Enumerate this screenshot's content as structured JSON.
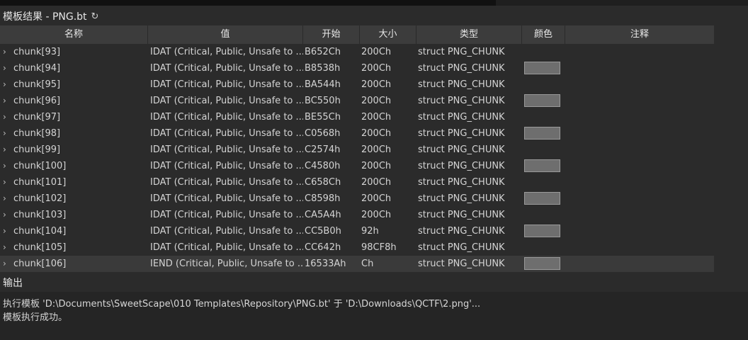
{
  "panel": {
    "title": "模板结果 - PNG.bt",
    "refresh_icon": "↻"
  },
  "columns": [
    "名称",
    "值",
    "开始",
    "大小",
    "类型",
    "颜色",
    "注释"
  ],
  "rows": [
    {
      "name": "chunk[93]",
      "value": "IDAT  (Critical, Public, Unsafe to ...",
      "start": "B652Ch",
      "size": "200Ch",
      "type": "struct PNG_CHUNK",
      "swatch": false
    },
    {
      "name": "chunk[94]",
      "value": "IDAT  (Critical, Public, Unsafe to ...",
      "start": "B8538h",
      "size": "200Ch",
      "type": "struct PNG_CHUNK",
      "swatch": true
    },
    {
      "name": "chunk[95]",
      "value": "IDAT  (Critical, Public, Unsafe to ...",
      "start": "BA544h",
      "size": "200Ch",
      "type": "struct PNG_CHUNK",
      "swatch": false
    },
    {
      "name": "chunk[96]",
      "value": "IDAT  (Critical, Public, Unsafe to ...",
      "start": "BC550h",
      "size": "200Ch",
      "type": "struct PNG_CHUNK",
      "swatch": true
    },
    {
      "name": "chunk[97]",
      "value": "IDAT  (Critical, Public, Unsafe to ...",
      "start": "BE55Ch",
      "size": "200Ch",
      "type": "struct PNG_CHUNK",
      "swatch": false
    },
    {
      "name": "chunk[98]",
      "value": "IDAT  (Critical, Public, Unsafe to ...",
      "start": "C0568h",
      "size": "200Ch",
      "type": "struct PNG_CHUNK",
      "swatch": true
    },
    {
      "name": "chunk[99]",
      "value": "IDAT  (Critical, Public, Unsafe to ...",
      "start": "C2574h",
      "size": "200Ch",
      "type": "struct PNG_CHUNK",
      "swatch": false
    },
    {
      "name": "chunk[100]",
      "value": "IDAT  (Critical, Public, Unsafe to ...",
      "start": "C4580h",
      "size": "200Ch",
      "type": "struct PNG_CHUNK",
      "swatch": true
    },
    {
      "name": "chunk[101]",
      "value": "IDAT  (Critical, Public, Unsafe to ...",
      "start": "C658Ch",
      "size": "200Ch",
      "type": "struct PNG_CHUNK",
      "swatch": false
    },
    {
      "name": "chunk[102]",
      "value": "IDAT  (Critical, Public, Unsafe to ...",
      "start": "C8598h",
      "size": "200Ch",
      "type": "struct PNG_CHUNK",
      "swatch": true
    },
    {
      "name": "chunk[103]",
      "value": "IDAT  (Critical, Public, Unsafe to ...",
      "start": "CA5A4h",
      "size": "200Ch",
      "type": "struct PNG_CHUNK",
      "swatch": false
    },
    {
      "name": "chunk[104]",
      "value": "IDAT  (Critical, Public, Unsafe to ...",
      "start": "CC5B0h",
      "size": "92h",
      "type": "struct PNG_CHUNK",
      "swatch": true
    },
    {
      "name": "chunk[105]",
      "value": "IDAT  (Critical, Public, Unsafe to ...",
      "start": "CC642h",
      "size": "98CF8h",
      "type": "struct PNG_CHUNK",
      "swatch": false
    },
    {
      "name": "chunk[106]",
      "value": "IEND  (Critical, Public, Unsafe to ...",
      "start": "16533Ah",
      "size": "Ch",
      "type": "struct PNG_CHUNK",
      "swatch": true,
      "selected": true
    }
  ],
  "output": {
    "title": "输出",
    "lines": [
      "执行模板 'D:\\Documents\\SweetScape\\010 Templates\\Repository\\PNG.bt' 于 'D:\\Downloads\\QCTF\\2.png'...",
      "模板执行成功。"
    ]
  },
  "colors": {
    "background": "#2b2b2b",
    "header": "#3c3c3c",
    "swatch": "#6e6e6e",
    "selected_row": "#3a3a3a"
  }
}
